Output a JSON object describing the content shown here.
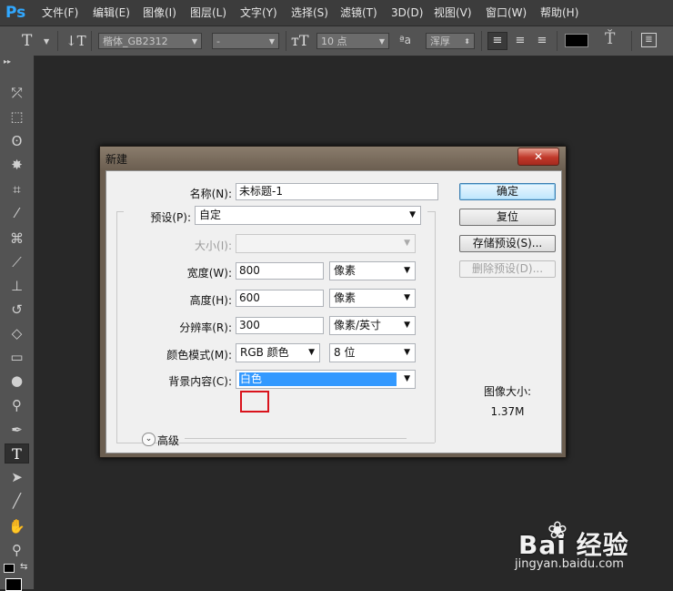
{
  "app": {
    "logo": "Ps"
  },
  "menu": [
    "文件(F)",
    "编辑(E)",
    "图像(I)",
    "图层(L)",
    "文字(Y)",
    "选择(S)",
    "滤镜(T)",
    "3D(D)",
    "视图(V)",
    "窗口(W)",
    "帮助(H)"
  ],
  "options_bar": {
    "tool_icon": "text-tool-icon",
    "font_family": "楷体_GB2312",
    "font_style": "-",
    "font_size": "10 点",
    "aa_label": "ªa",
    "antialias": "浑厚",
    "color_swatch": "#000000"
  },
  "toolbar": {
    "tools": [
      "move-tool-icon",
      "marquee-tool-icon",
      "lasso-tool-icon",
      "magic-wand-icon",
      "crop-tool-icon",
      "eyedropper-icon",
      "healing-brush-icon",
      "brush-tool-icon",
      "clone-stamp-icon",
      "history-brush-icon",
      "eraser-icon",
      "gradient-tool-icon",
      "blur-tool-icon",
      "dodge-tool-icon",
      "pen-tool-icon",
      "type-tool-icon",
      "path-selection-icon",
      "line-tool-icon",
      "hand-tool-icon",
      "zoom-tool-icon"
    ],
    "active_tool": "type-tool-icon"
  },
  "dialog": {
    "title": "新建",
    "close_label": "✕",
    "name_label": "名称(N):",
    "name_value": "未标题-1",
    "preset_label": "预设(P):",
    "preset_value": "自定",
    "size_label": "大小(I):",
    "size_value": "",
    "width_label": "宽度(W):",
    "width_value": "800",
    "width_unit": "像素",
    "height_label": "高度(H):",
    "height_value": "600",
    "height_unit": "像素",
    "resolution_label": "分辨率(R):",
    "resolution_value": "300",
    "resolution_unit": "像素/英寸",
    "color_mode_label": "颜色模式(M):",
    "color_mode_value": "RGB 颜色",
    "bit_depth_value": "8 位",
    "background_label": "背景内容(C):",
    "background_value": "白色",
    "advanced_label": "高级",
    "ok_label": "确定",
    "reset_label": "复位",
    "save_preset_label": "存储预设(S)...",
    "delete_preset_label": "删除预设(D)...",
    "image_size_label": "图像大小:",
    "image_size_value": "1.37M"
  },
  "watermark": {
    "logo_text": "Bai  经验",
    "url": "jingyan.baidu.com"
  }
}
